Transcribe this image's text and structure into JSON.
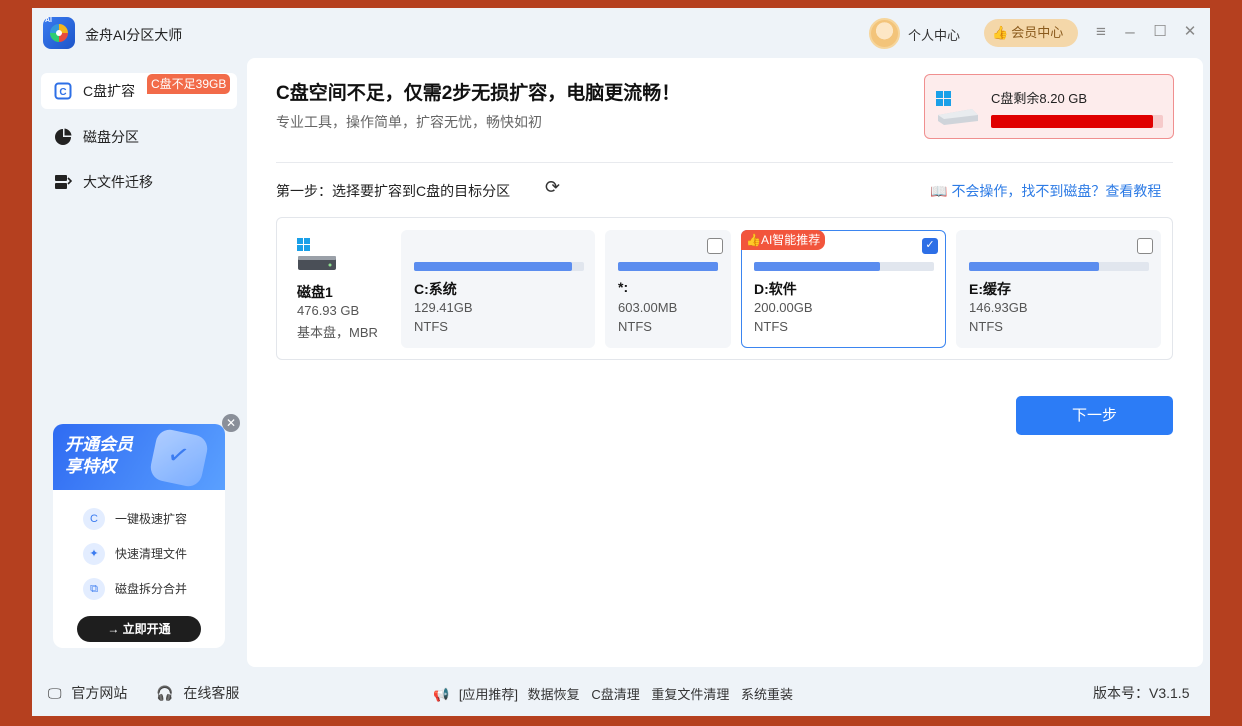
{
  "window": {
    "title": "金舟AI分区大师",
    "user_center": "个人中心",
    "vip_center": "会员中心",
    "controls": {
      "menu": "≡",
      "minimize": "–",
      "maximize": "☐",
      "close": "✕"
    }
  },
  "sidebar": {
    "items": [
      {
        "label": "C盘扩容",
        "icon": "disk-icon"
      },
      {
        "label": "磁盘分区",
        "icon": "pie-icon"
      },
      {
        "label": "大文件迁移",
        "icon": "migrate-icon"
      }
    ],
    "c_badge": "C盘不足39GB"
  },
  "promo": {
    "title_line1": "开通会员",
    "title_line2": "享特权",
    "features": [
      "一键极速扩容",
      "快速清理文件",
      "磁盘拆分合并"
    ],
    "button": "立即开通",
    "close": "✕"
  },
  "main": {
    "headline": "C盘空间不足，仅需2步无损扩容，电脑更流畅！",
    "subline": "专业工具，操作简单，扩容无忧，畅快如初",
    "c_remaining_label": "C盘剩余8.20 GB",
    "c_remaining_fill": 0.94,
    "step_label": "第一步：选择要扩容到C盘的目标分区",
    "help_link": "不会操作，找不到磁盘？查看教程",
    "next_button": "下一步"
  },
  "disk": {
    "name": "磁盘1",
    "size": "476.93 GB",
    "type": "基本盘，MBR"
  },
  "partitions": [
    {
      "name": "C:系统",
      "size": "129.41GB",
      "fs": "NTFS",
      "used": 0.93,
      "checkbox": false,
      "selected": false
    },
    {
      "name": "*:",
      "size": "603.00MB",
      "fs": "NTFS",
      "used": 1.0,
      "checkbox": true,
      "checked": false,
      "selected": false
    },
    {
      "name": "D:软件",
      "size": "200.00GB",
      "fs": "NTFS",
      "used": 0.7,
      "checkbox": true,
      "checked": true,
      "selected": true,
      "tag": "AI智能推荐"
    },
    {
      "name": "E:缓存",
      "size": "146.93GB",
      "fs": "NTFS",
      "used": 0.72,
      "checkbox": true,
      "checked": false,
      "selected": false
    }
  ],
  "footer": {
    "website": "官方网站",
    "support": "在线客服",
    "recommend_prefix": "[应用推荐]",
    "links": [
      "数据恢复",
      "C盘清理",
      "重复文件清理",
      "系统重装"
    ],
    "version": "版本号：V3.1.5"
  }
}
